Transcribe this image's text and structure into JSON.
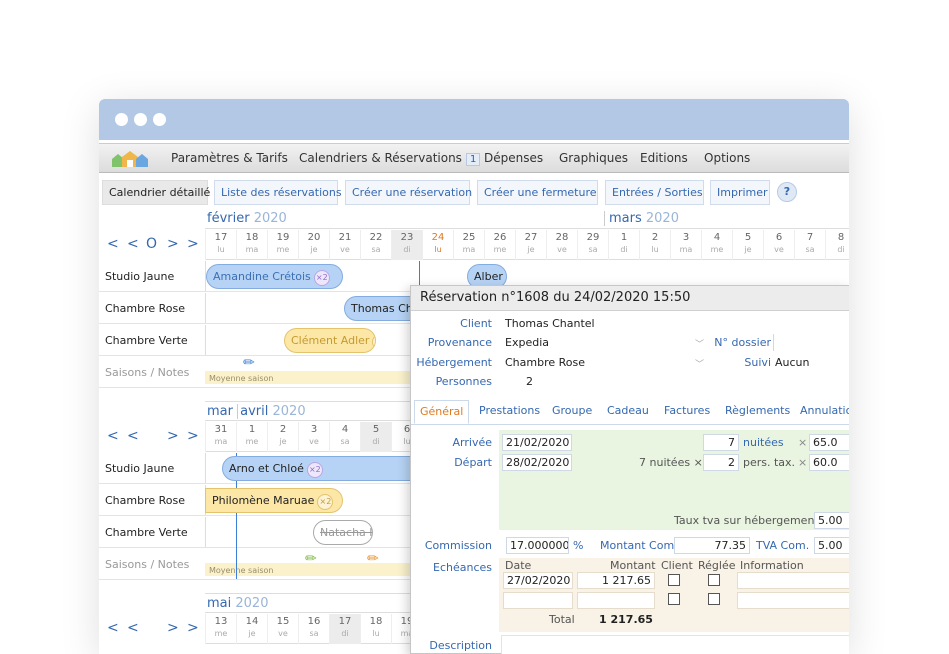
{
  "menu": {
    "items": [
      "Paramètres & Tarifs",
      "Calendriers & Réservations",
      "Dépenses",
      "Graphiques",
      "Editions",
      "Options"
    ],
    "badge": "1"
  },
  "subnav": {
    "items": [
      "Calendrier détaillé",
      "Liste des réservations",
      "Créer une réservation",
      "Créer une fermeture",
      "Entrées / Sorties",
      "Imprimer"
    ],
    "help": "?"
  },
  "nav": {
    "b1": "<",
    "b2": "<",
    "b3": "O",
    "b4": ">",
    "b5": ">"
  },
  "block1": {
    "month1": "février",
    "month2": "mars",
    "year": "2020",
    "days": [
      [
        "17",
        "lu"
      ],
      [
        "18",
        "ma"
      ],
      [
        "19",
        "me"
      ],
      [
        "20",
        "je"
      ],
      [
        "21",
        "ve"
      ],
      [
        "22",
        "sa"
      ],
      [
        "23",
        "di"
      ],
      [
        "24",
        "lu"
      ],
      [
        "25",
        "ma"
      ],
      [
        "26",
        "me"
      ],
      [
        "27",
        "je"
      ],
      [
        "28",
        "ve"
      ],
      [
        "29",
        "sa"
      ],
      [
        "1",
        "di"
      ],
      [
        "2",
        "lu"
      ],
      [
        "3",
        "ma"
      ],
      [
        "4",
        "me"
      ],
      [
        "5",
        "je"
      ],
      [
        "6",
        "ve"
      ],
      [
        "7",
        "sa"
      ],
      [
        "8",
        "di"
      ]
    ],
    "rows": [
      "Studio Jaune",
      "Chambre Rose",
      "Chambre Verte",
      "Saisons / Notes"
    ],
    "bars": {
      "b1": "Amandine Crétois",
      "b2": "Alber",
      "b3": "Thomas Cha",
      "b4": "Clément Adler",
      "x2": "×2"
    },
    "season": "Moyenne saison"
  },
  "block2": {
    "month1": "mar",
    "month2": "avril",
    "year": "2020",
    "days": [
      [
        "31",
        "ma"
      ],
      [
        "1",
        "me"
      ],
      [
        "2",
        "je"
      ],
      [
        "3",
        "ve"
      ],
      [
        "4",
        "sa"
      ],
      [
        "5",
        "di"
      ],
      [
        "6",
        "lu"
      ]
    ],
    "rows": [
      "Studio Jaune",
      "Chambre Rose",
      "Chambre Verte",
      "Saisons / Notes"
    ],
    "bars": {
      "b1": "Arno et Chloé",
      "b2": "Philomène Maruae",
      "b3": "Natacha M"
    },
    "season": "Moyenne saison"
  },
  "block3": {
    "month": "mai",
    "year": "2020",
    "days": [
      [
        "13",
        "me"
      ],
      [
        "14",
        "je"
      ],
      [
        "15",
        "ve"
      ],
      [
        "16",
        "sa"
      ],
      [
        "17",
        "di"
      ],
      [
        "18",
        "lu"
      ],
      [
        "19",
        "ma"
      ]
    ]
  },
  "dialog": {
    "title": "Réservation n°1608 du 24/02/2020 15:50",
    "labels": {
      "client": "Client",
      "provenance": "Provenance",
      "hebergement": "Hébergement",
      "personnes": "Personnes",
      "dossier": "N° dossier",
      "suivi": "Suivi",
      "arrivee": "Arrivée",
      "depart": "Départ",
      "commission": "Commission",
      "echeances": "Echéances",
      "description": "Description"
    },
    "values": {
      "client": "Thomas Chantel",
      "provenance": "Expedia",
      "hebergement": "Chambre Rose",
      "personnes": "2",
      "suivi": "Aucun"
    },
    "tabs": [
      "Général",
      "Prestations",
      "Groupe",
      "Cadeau",
      "Factures",
      "Règlements",
      "Annulatio"
    ],
    "arrivee": "21/02/2020",
    "depart": "28/02/2020",
    "nuitees_val": "7",
    "nuitees": "nuitées",
    "mult": "×",
    "price1": "65.0",
    "nuitees_txt": "7 nuitées ×",
    "pers_val": "2",
    "pers": "pers. tax.",
    "price2": "60.0",
    "tva_label": "Taux tva sur hébergement",
    "tva_val": "5.00",
    "commission": "17.000000",
    "pct": "%",
    "montant_com_label": "Montant Com.",
    "montant_com": "77.35",
    "tva_com_label": "TVA Com.",
    "tva_com": "5.00",
    "ech_headers": {
      "date": "Date",
      "montant": "Montant",
      "client": "Client",
      "reglee": "Réglée",
      "info": "Information"
    },
    "ech_row": {
      "date": "27/02/2020",
      "montant": "1 217.65"
    },
    "total_label": "Total",
    "total": "1 217.65"
  }
}
